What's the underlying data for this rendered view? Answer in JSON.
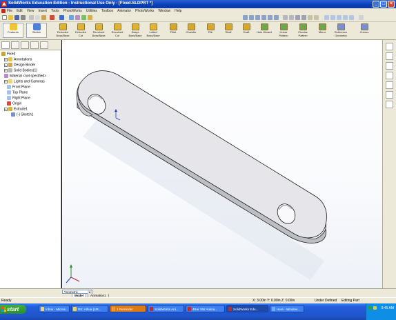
{
  "window": {
    "title": "SolidWorks Education Edition - Instructional Use Only - [Fixed.SLDPRT *]",
    "min_label": "_",
    "max_label": "□",
    "close_label": "×"
  },
  "menu": [
    "File",
    "Edit",
    "View",
    "Insert",
    "Tools",
    "PhotoWorks",
    "Utilities",
    "Toolbox",
    "Animator",
    "PhotoWorks",
    "Window",
    "Help"
  ],
  "command_manager": {
    "tabs": [
      {
        "label": "Features",
        "icon": "features-icon"
      },
      {
        "label": "Sketch",
        "icon": "sketch-icon"
      }
    ],
    "commands": [
      {
        "label": "Extruded\nBoss/Base",
        "icon": "extrude-boss-icon"
      },
      {
        "label": "Extruded\nCut",
        "icon": "extrude-cut-icon"
      },
      {
        "label": "Revolved\nBoss/Base",
        "icon": "revolve-boss-icon"
      },
      {
        "label": "Revolved\nCut",
        "icon": "revolve-cut-icon"
      },
      {
        "label": "Swept\nBoss/Base",
        "icon": "swept-boss-icon"
      },
      {
        "label": "Lofted\nBoss/Base",
        "icon": "lofted-boss-icon"
      },
      {
        "label": "Fillet",
        "icon": "fillet-icon"
      },
      {
        "label": "Chamfer",
        "icon": "chamfer-icon"
      },
      {
        "label": "Rib",
        "icon": "rib-icon"
      },
      {
        "label": "Shell",
        "icon": "shell-icon"
      },
      {
        "label": "Draft",
        "icon": "draft-icon"
      },
      {
        "label": "Hole Wizard",
        "icon": "hole-wizard-icon"
      },
      {
        "label": "Linear\nPattern",
        "icon": "linear-pattern-icon"
      },
      {
        "label": "Circular\nPattern",
        "icon": "circular-pattern-icon"
      },
      {
        "label": "Mirror",
        "icon": "mirror-icon"
      },
      {
        "label": "Reference\nGeometry",
        "icon": "reference-geometry-icon"
      },
      {
        "label": "Curves",
        "icon": "curves-icon"
      }
    ]
  },
  "tree": {
    "root": "Fixed",
    "nodes": [
      {
        "label": "Annotations",
        "icon": "annotations-icon"
      },
      {
        "label": "Design Binder",
        "icon": "design-binder-icon"
      },
      {
        "label": "Solid Bodies(1)",
        "icon": "solid-bodies-icon"
      },
      {
        "label": "Material <not specified>",
        "icon": "material-icon"
      },
      {
        "label": "Lights and Cameras",
        "icon": "lights-icon"
      },
      {
        "label": "Front Plane",
        "icon": "plane-icon"
      },
      {
        "label": "Top Plane",
        "icon": "plane-icon"
      },
      {
        "label": "Right Plane",
        "icon": "plane-icon"
      },
      {
        "label": "Origin",
        "icon": "origin-icon"
      },
      {
        "label": "Extrude1",
        "icon": "extrude-feature-icon"
      },
      {
        "label": "(-) Sketch1",
        "icon": "sketch-feature-icon"
      }
    ]
  },
  "viewport": {
    "view_orientation": "*Isometric",
    "tabs": [
      "Model",
      "Animation1"
    ]
  },
  "status": {
    "left": "Ready",
    "coords": "X: 3.00in  Y: 0.00in  Z: 0.00in",
    "state": "Under Defined",
    "mode": "Editing Part"
  },
  "taskbar": {
    "start_label": "start",
    "buttons": [
      {
        "label": "Inbox - Micros...",
        "style": "normal"
      },
      {
        "label": "RE: Alhua (UR...",
        "style": "normal"
      },
      {
        "label": "1 Reminder",
        "style": "orange"
      },
      {
        "label": "SolidWorks Ani...",
        "style": "normal"
      },
      {
        "label": "4Bar SW Anima...",
        "style": "normal"
      },
      {
        "label": "SolidWorks Edu...",
        "style": "active"
      },
      {
        "label": "Here - Window...",
        "style": "normal"
      }
    ],
    "clock": "9:45 AM"
  },
  "colors": {
    "titlebar": "#0a3fb5",
    "part_face": "#e4e4e8",
    "part_edge": "#2a2a2a",
    "taskbar": "#245edb"
  }
}
